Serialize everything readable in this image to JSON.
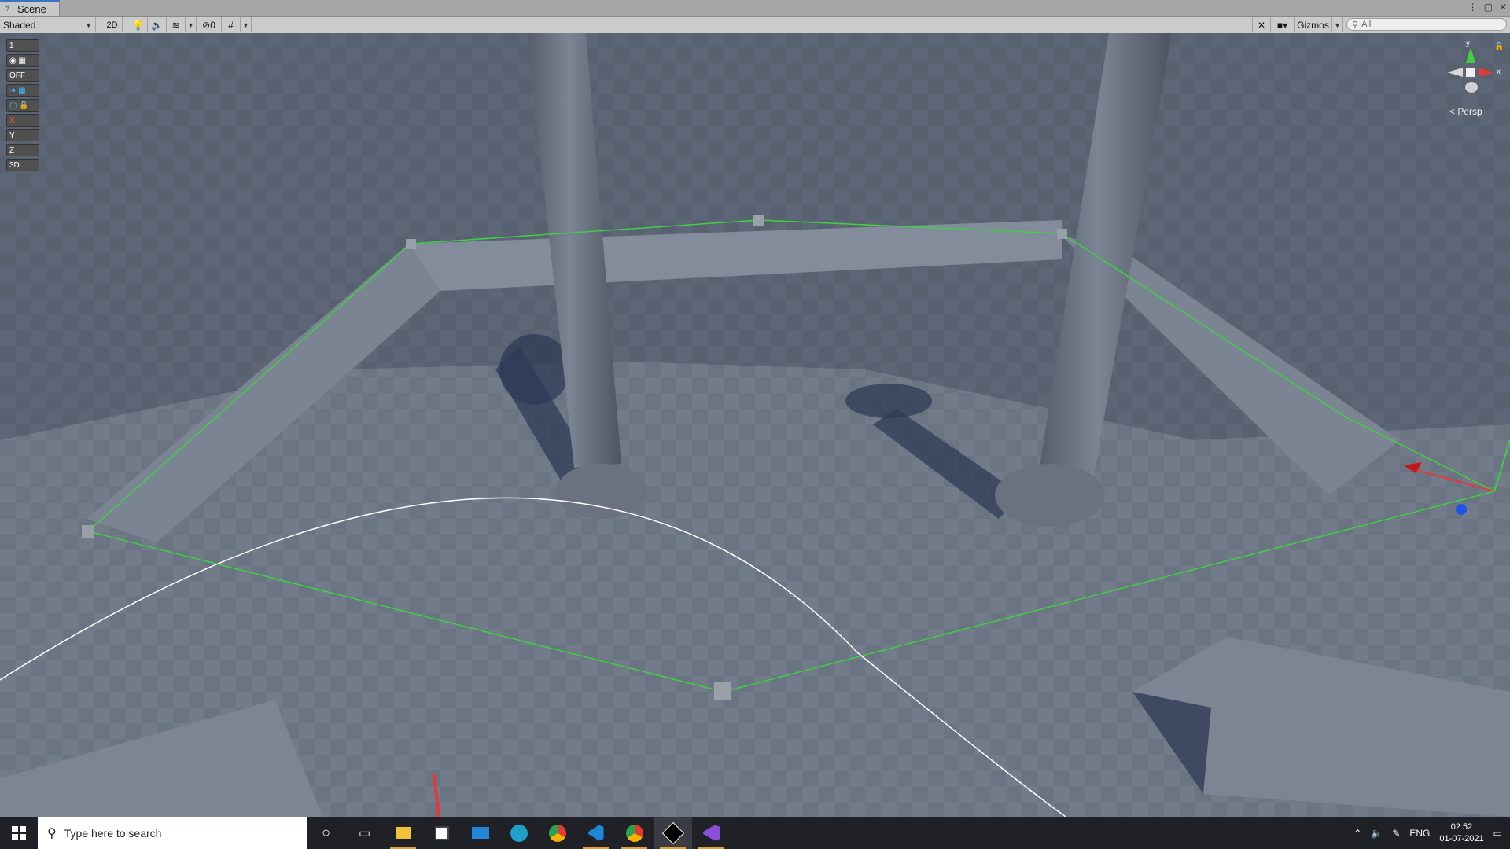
{
  "window": {
    "tab_title": "Scene",
    "tab_icon": "scene-icon"
  },
  "toolbar": {
    "shading_mode": "Shaded",
    "mode_2d_label": "2D",
    "hidden_count": "0",
    "gizmos_label": "Gizmos",
    "search_placeholder": "All"
  },
  "tool_palette": {
    "items": [
      {
        "label": "1",
        "icon": "scale-indicator-icon"
      },
      {
        "label": "",
        "icon": "visibility-eye-icon"
      },
      {
        "label": "OFF",
        "icon": "toggle-off-icon"
      },
      {
        "label": "",
        "icon": "arrow-grid-icon"
      },
      {
        "label": "",
        "icon": "lock-grid-icon"
      },
      {
        "label": "X",
        "icon": "x-axis-grid-icon"
      },
      {
        "label": "Y",
        "icon": "y-axis-grid-icon"
      },
      {
        "label": "Z",
        "icon": "z-axis-grid-icon"
      },
      {
        "label": "3D",
        "icon": "3d-mode-icon"
      }
    ]
  },
  "view": {
    "projection_label": "< Persp",
    "axis_x_label": "x",
    "axis_y_label": "y"
  },
  "taskbar": {
    "search_placeholder": "Type here to search",
    "apps": [
      "cortana",
      "task-view",
      "file-explorer",
      "store",
      "mail",
      "edge",
      "chrome",
      "vscode",
      "chrome",
      "unity",
      "visual-studio"
    ],
    "language": "ENG",
    "time": "02:52",
    "date": "01-07-2021"
  },
  "colors": {
    "floor": "#6e7888",
    "path_line": "#3fd13f",
    "circle": "#ffffff",
    "toolbar_bg": "#cbcbcb",
    "taskbar_bg": "#1f2127"
  }
}
